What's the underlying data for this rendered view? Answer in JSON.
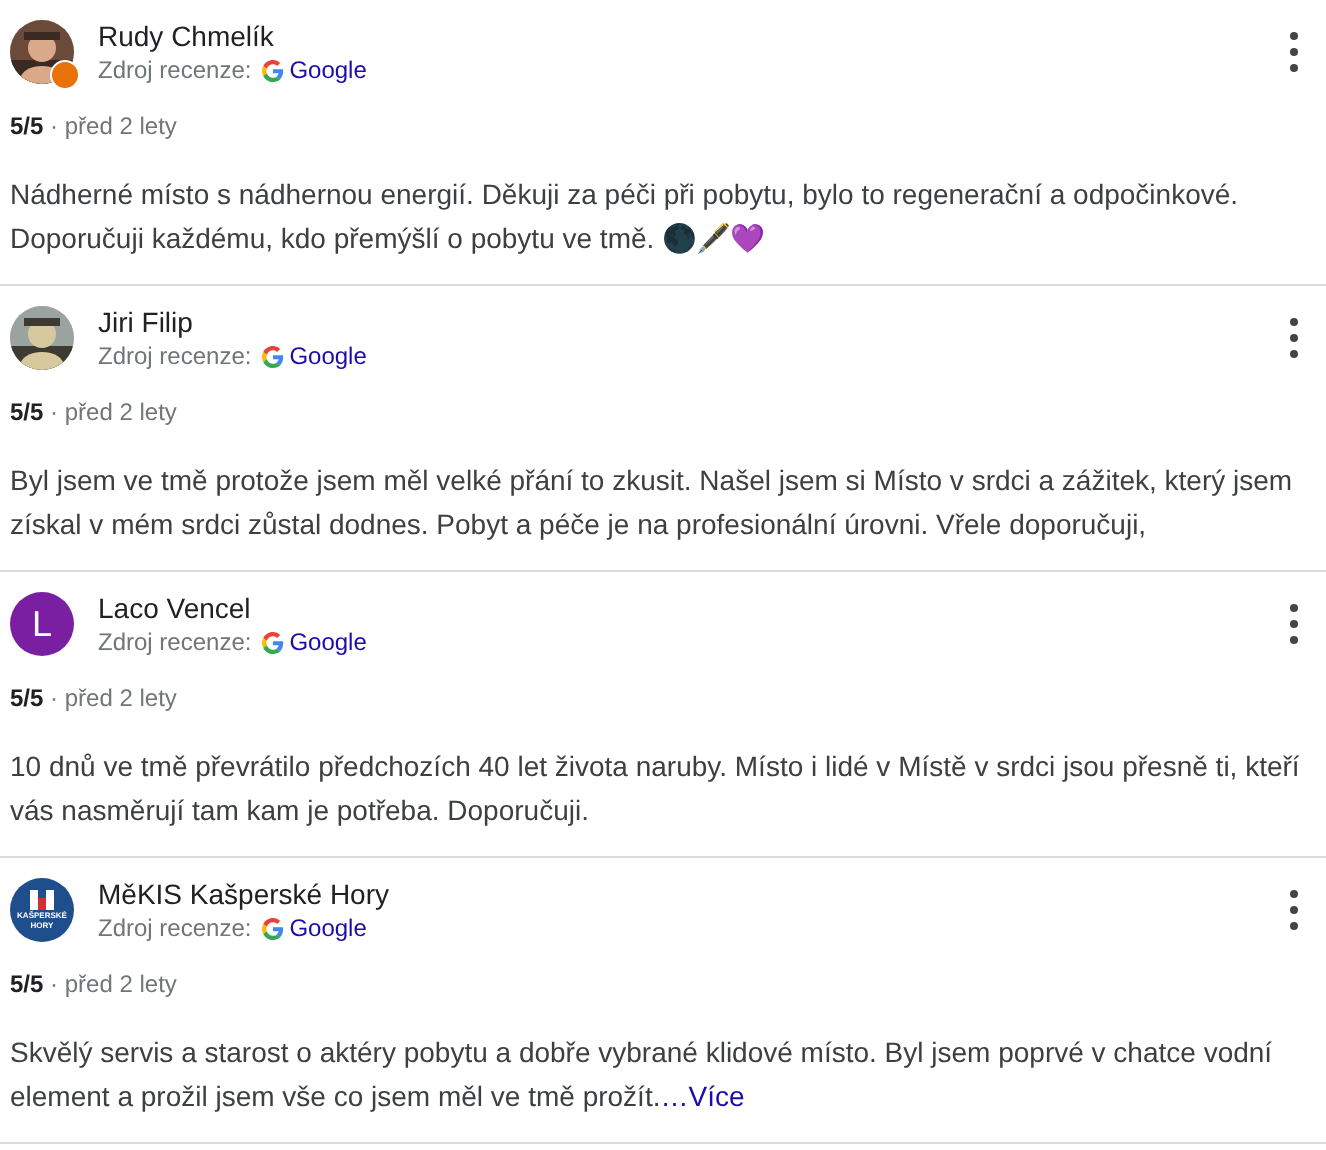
{
  "separator": "·",
  "reviews": [
    {
      "author": "Rudy Chmelík",
      "avatar": {
        "kind": "picture",
        "badge": true
      },
      "source_label": "Zdroj recenze:",
      "source": "Google",
      "rating": "5/5",
      "time": "před 2 lety",
      "text": "Nádherné místo s nádhernou energií. Děkuji za péči při pobytu, bylo to regenerační a odpočinkové. Doporučuji každému, kdo přemýšlí o pobytu ve tmě. 🌑🖋️💜"
    },
    {
      "author": "Jiri Filip",
      "avatar": {
        "kind": "picture",
        "badge": false
      },
      "source_label": "Zdroj recenze:",
      "source": "Google",
      "rating": "5/5",
      "time": "před 2 lety",
      "text": "Byl jsem ve tmě protože jsem měl velké přání to zkusit. Našel jsem si Místo v srdci a zážitek, který jsem získal v mém srdci zůstal dodnes. Pobyt a péče je na profesionální úrovni. Vřele doporučuji,"
    },
    {
      "author": "Laco Vencel",
      "avatar": {
        "kind": "letter",
        "letter": "L",
        "color": "#7b1fa2"
      },
      "source_label": "Zdroj recenze:",
      "source": "Google",
      "rating": "5/5",
      "time": "před 2 lety",
      "text": "10 dnů ve tmě převrátilo předchozích 40 let života naruby. Místo i lidé v Místě v srdci jsou přesně ti, kteří vás nasměrují tam kam je potřeba. Doporučuji."
    },
    {
      "author": "MěKIS Kašperské Hory",
      "avatar": {
        "kind": "logo",
        "lines": [
          "KAŠPERSKÉ",
          "HORY"
        ]
      },
      "source_label": "Zdroj recenze:",
      "source": "Google",
      "rating": "5/5",
      "time": "před 2 lety",
      "text": "Skvělý servis a starost o aktéry pobytu a dobře vybrané klidové místo. Byl jsem poprvé v chatce vodní element a prožil jsem vše co jsem měl ve tmě prožít.",
      "more": "…Více"
    }
  ]
}
